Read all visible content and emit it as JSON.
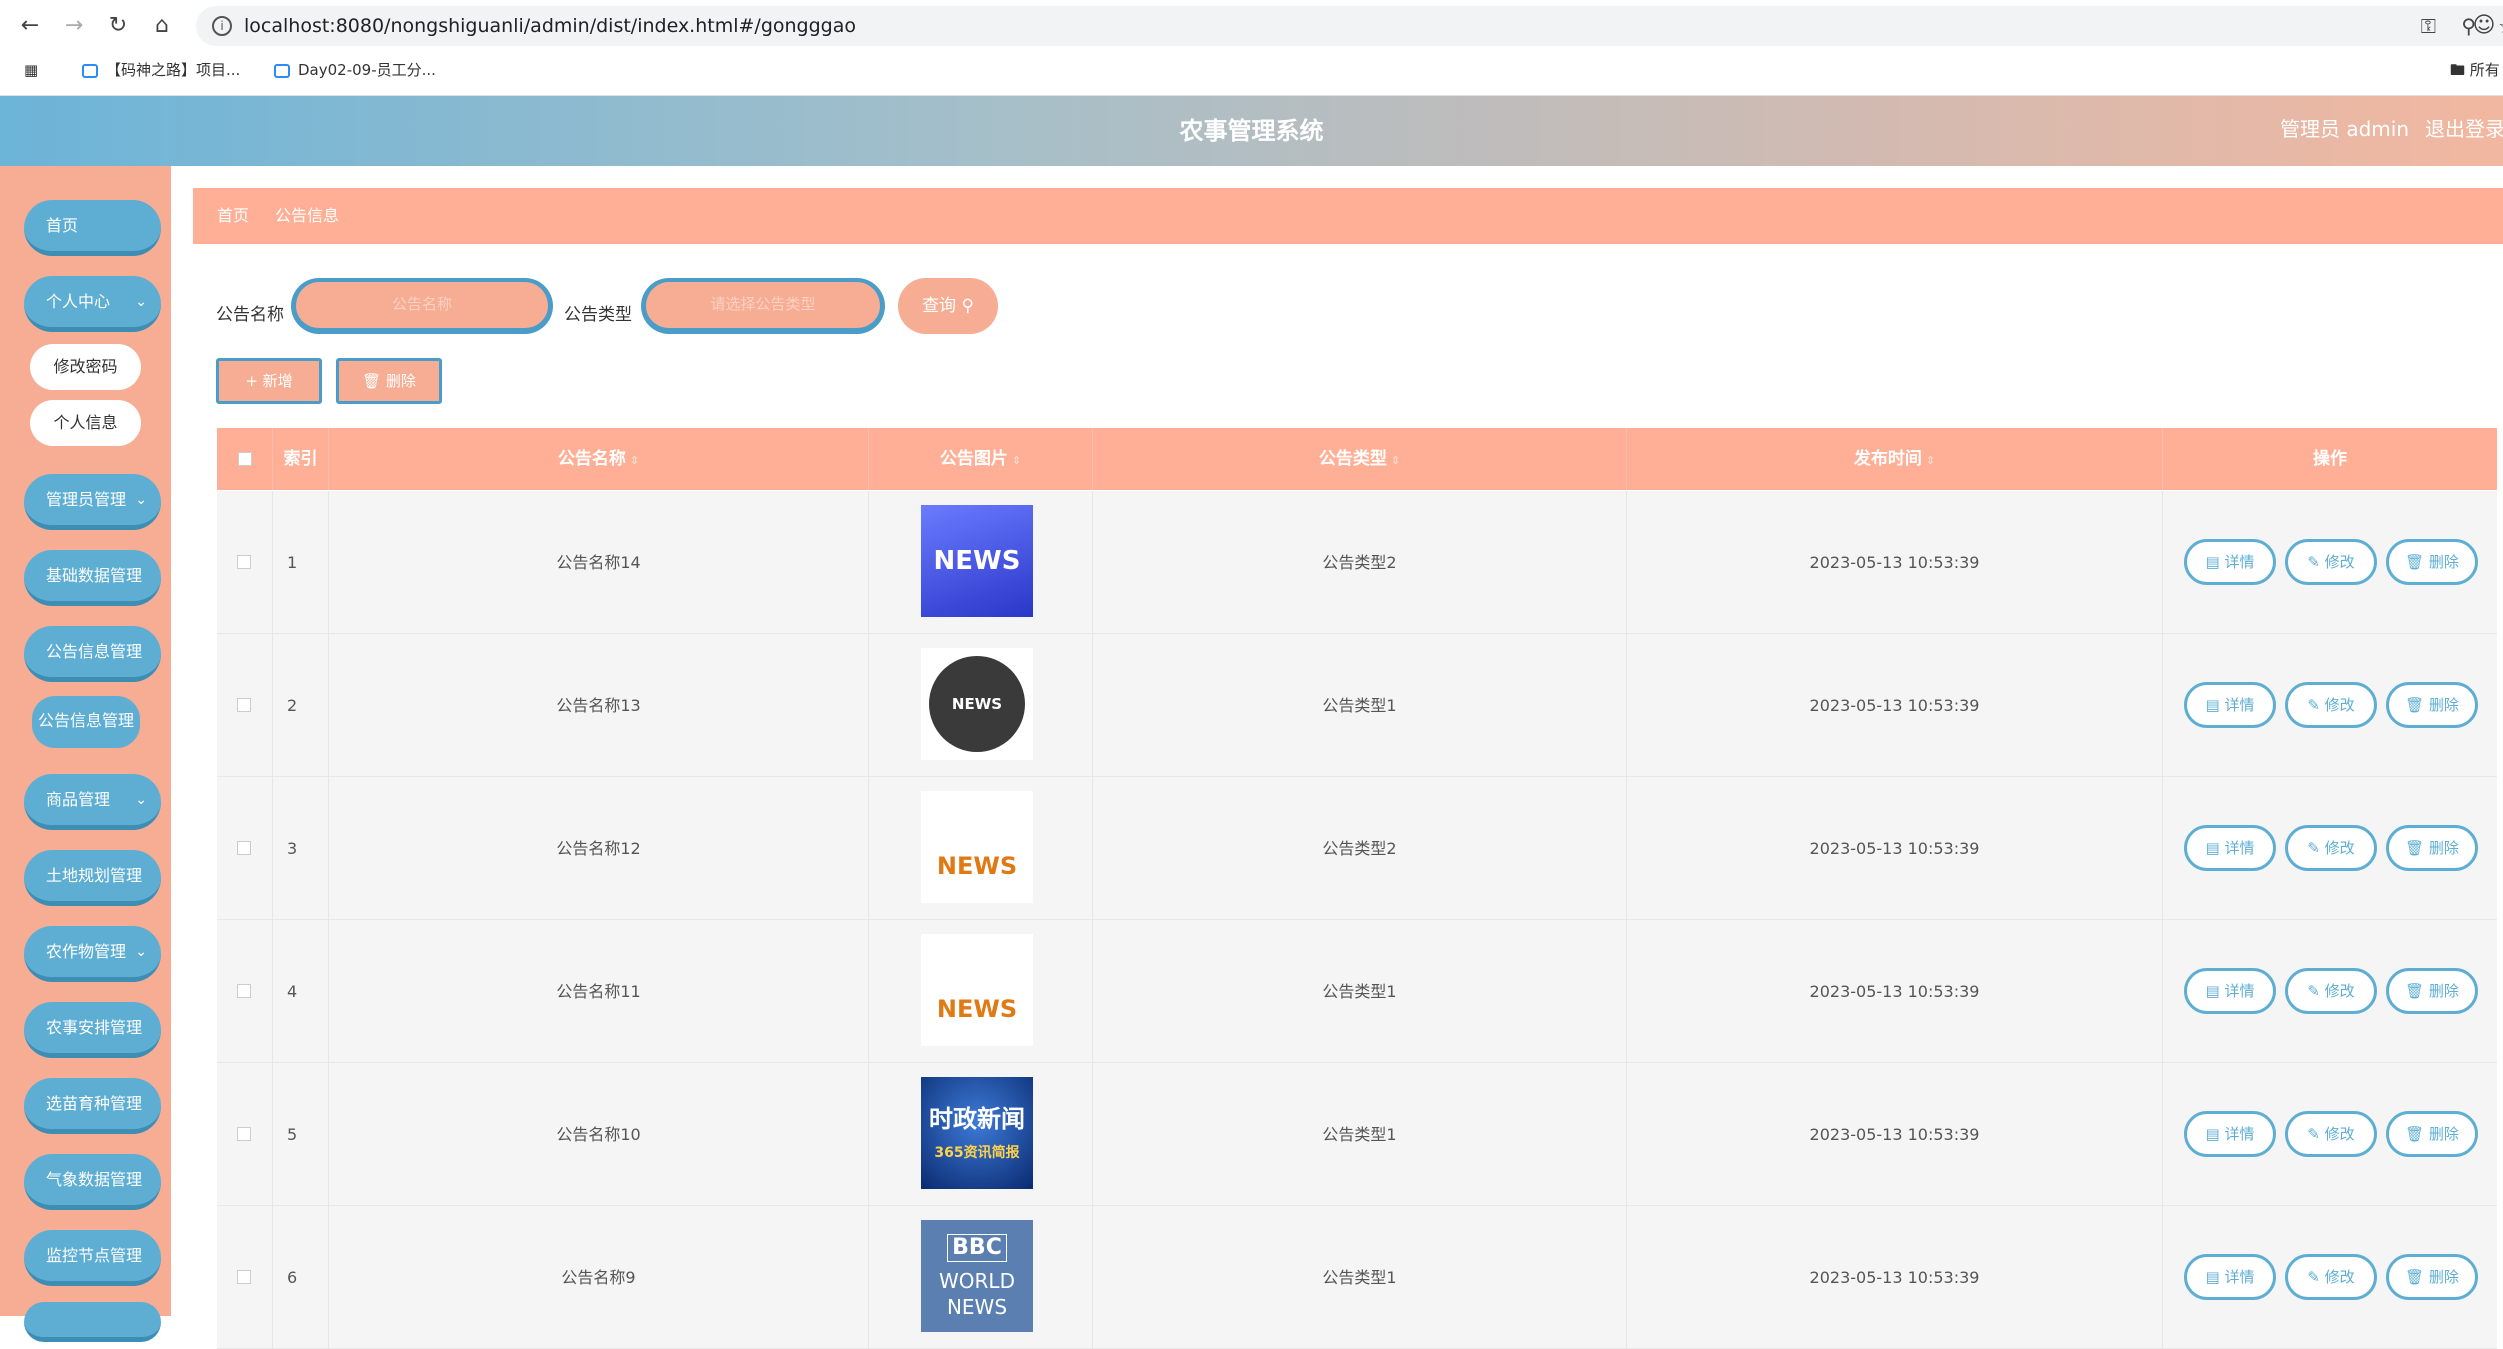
{
  "browser": {
    "url": "localhost:8080/nongshiguanli/admin/dist/index.html#/gongggao",
    "bookmarks": [
      "【码神之路】项目...",
      "Day02-09-员工分..."
    ],
    "bookmark_right": "所有"
  },
  "header": {
    "title": "农事管理系统",
    "user": "管理员 admin",
    "logout": "退出登录"
  },
  "sidebar": {
    "items": [
      {
        "label": "首页"
      },
      {
        "label": "个人中心"
      },
      {
        "label": "修改密码"
      },
      {
        "label": "个人信息"
      },
      {
        "label": "管理员管理"
      },
      {
        "label": "基础数据管理"
      },
      {
        "label": "公告信息管理"
      },
      {
        "label": "公告信息管理"
      },
      {
        "label": "商品管理"
      },
      {
        "label": "土地规划管理"
      },
      {
        "label": "农作物管理"
      },
      {
        "label": "农事安排管理"
      },
      {
        "label": "选苗育种管理"
      },
      {
        "label": "气象数据管理"
      },
      {
        "label": "监控节点管理"
      }
    ]
  },
  "breadcrumb": {
    "home": "首页",
    "current": "公告信息"
  },
  "search": {
    "name_label": "公告名称",
    "name_placeholder": "公告名称",
    "type_label": "公告类型",
    "type_placeholder": "请选择公告类型",
    "query": "查询"
  },
  "actions": {
    "add": "新增",
    "delete": "删除"
  },
  "table": {
    "headers": [
      "索引",
      "公告名称",
      "公告图片",
      "公告类型",
      "发布时间",
      "操作"
    ],
    "rows": [
      {
        "index": "1",
        "name": "公告名称14",
        "image": "NEWS",
        "type": "公告类型2",
        "time": "2023-05-13 10:53:39"
      },
      {
        "index": "2",
        "name": "公告名称13",
        "image": "NEWS",
        "type": "公告类型1",
        "time": "2023-05-13 10:53:39"
      },
      {
        "index": "3",
        "name": "公告名称12",
        "image": "NEWS",
        "type": "公告类型2",
        "time": "2023-05-13 10:53:39"
      },
      {
        "index": "4",
        "name": "公告名称11",
        "image": "NEWS",
        "type": "公告类型1",
        "time": "2023-05-13 10:53:39"
      },
      {
        "index": "5",
        "name": "公告名称10",
        "image": "时政新闻",
        "image_sub": "365资讯简报",
        "type": "公告类型1",
        "time": "2023-05-13 10:53:39"
      },
      {
        "index": "6",
        "name": "公告名称9",
        "image": "BBC",
        "image_sub": "WORLD NEWS",
        "type": "公告类型1",
        "time": "2023-05-13 10:53:39"
      }
    ]
  },
  "row_buttons": {
    "detail": "详情",
    "edit": "修改",
    "delete": "删除"
  },
  "colors": {
    "primary": "#5eaed4",
    "accent": "#ffaf95",
    "sidebar": "#f7ad93"
  }
}
